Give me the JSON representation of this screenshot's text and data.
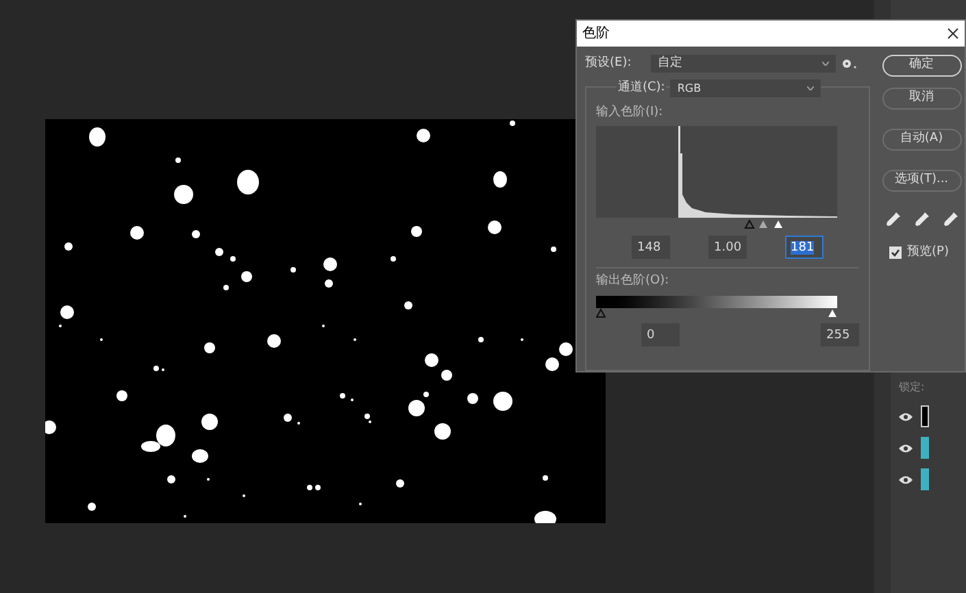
{
  "dialog": {
    "title": "色阶",
    "preset_label": "预设(E):",
    "preset": "自定",
    "channel_label": "通道(C):",
    "channel": "RGB",
    "input_label": "输入色阶(I):",
    "input_values": [
      {
        "value": "148",
        "selected": false
      },
      {
        "value": "1.00",
        "selected": false
      },
      {
        "value": "181",
        "selected": true
      }
    ],
    "output_label": "输出色阶(O):",
    "output_values": [
      {
        "value": "0",
        "selected": false
      },
      {
        "value": "255",
        "selected": false
      }
    ],
    "buttons": [
      {
        "label": "确定",
        "default": true
      },
      {
        "label": "取消",
        "default": false
      },
      {
        "label": "自动(A)",
        "default": false
      },
      {
        "label": "选项(T)...",
        "default": false
      }
    ],
    "preview": {
      "label": "预览(P)",
      "checked": true
    }
  },
  "layers_panel": {
    "lock_label": "锁定:",
    "layers": [
      {
        "visible": true
      },
      {
        "visible": true
      },
      {
        "visible": true
      }
    ]
  }
}
